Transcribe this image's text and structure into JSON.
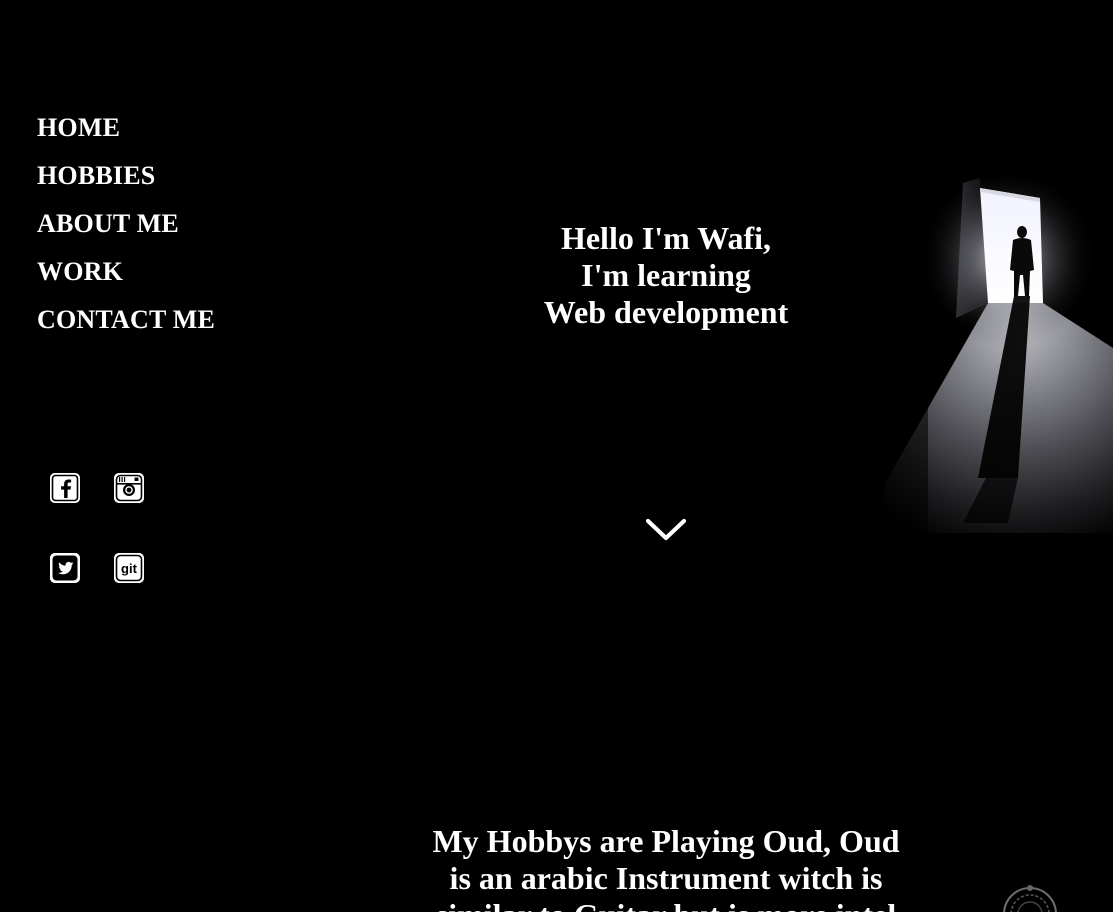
{
  "nav": {
    "items": [
      {
        "label": "HOME"
      },
      {
        "label": "HOBBIES"
      },
      {
        "label": "ABOUT ME"
      },
      {
        "label": "WORK"
      },
      {
        "label": "CONTACT ME"
      }
    ]
  },
  "social": {
    "icons": [
      "facebook-icon",
      "instagram-icon",
      "twitter-icon",
      "git-icon"
    ]
  },
  "hero": {
    "lines": [
      "Hello I'm Wafi,",
      "I'm learning",
      "Web development"
    ]
  },
  "hobbies": {
    "lines": [
      "My Hobbys are Playing Oud, Oud",
      "is an arabic Instrument witch is",
      "similar to Guitar but is more intel"
    ]
  },
  "colors": {
    "background": "#000000",
    "text": "#ffffff"
  }
}
